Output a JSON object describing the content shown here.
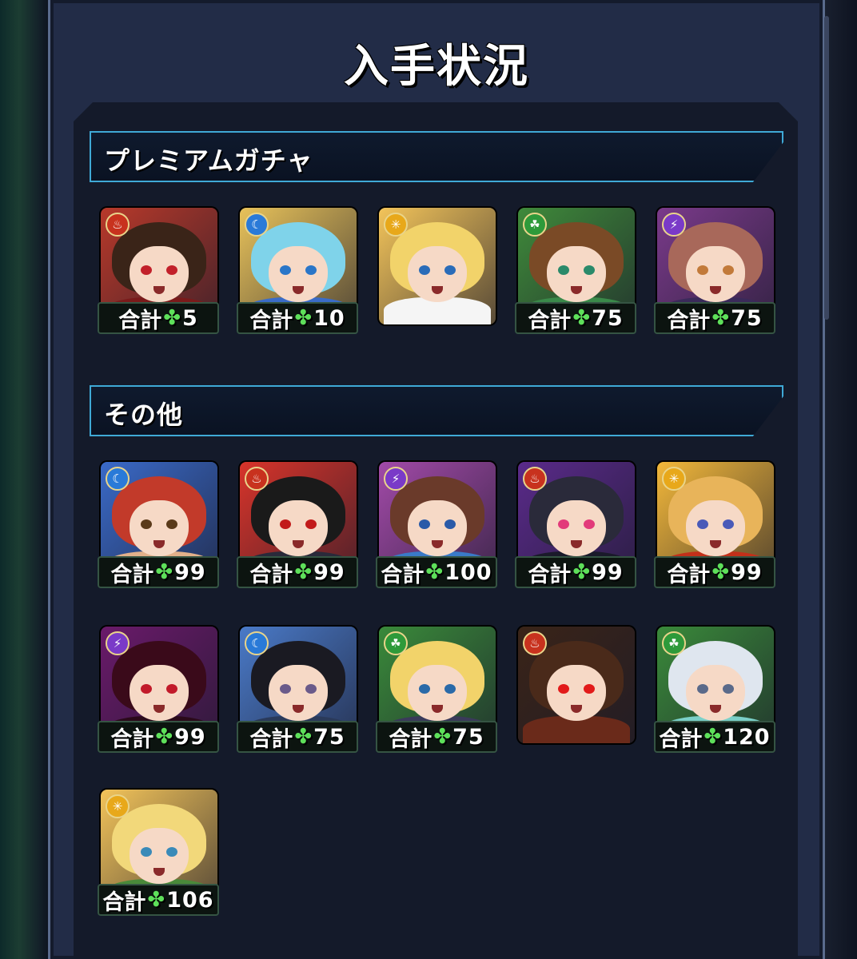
{
  "title": "入手状況",
  "sections": [
    {
      "label": "プレミアムガチャ",
      "items": [
        {
          "element": "fire",
          "hair": "#3a2418",
          "bg": "#b8392a",
          "outfit": "#7a1a1a",
          "eye": "#c2202a",
          "total_label": "合計",
          "total": "5"
        },
        {
          "element": "water",
          "hair": "#7fd3ea",
          "bg": "#e8c25a",
          "outfit": "#3a6cc8",
          "eye": "#2a76c8",
          "total_label": "合計",
          "total": "10"
        },
        {
          "element": "light",
          "hair": "#f2d36a",
          "bg": "#f3c45a",
          "outfit": "#f5f5f5",
          "eye": "#2a6cb8",
          "total_label": "",
          "total": ""
        },
        {
          "element": "wood",
          "hair": "#7a4a26",
          "bg": "#3f8a3a",
          "outfit": "#3a8a4a",
          "eye": "#2a8a6a",
          "total_label": "合計",
          "total": "75"
        },
        {
          "element": "dark",
          "hair": "#a8685a",
          "bg": "#7a3a8a",
          "outfit": "#3a2a5a",
          "eye": "#c27a3a",
          "total_label": "合計",
          "total": "75"
        }
      ]
    },
    {
      "label": "その他",
      "items": [
        {
          "element": "water",
          "hair": "#c23a2a",
          "bg": "#3a6ac8",
          "outfit": "#e2b08a",
          "eye": "#5a3a1a",
          "total_label": "合計",
          "total": "99"
        },
        {
          "element": "fire",
          "hair": "#1a1a1a",
          "bg": "#d8342a",
          "outfit": "#2a2a3a",
          "eye": "#c21a1a",
          "total_label": "合計",
          "total": "99"
        },
        {
          "element": "dark",
          "hair": "#6a3a2a",
          "bg": "#a24aa8",
          "outfit": "#3a7ac8",
          "eye": "#2a5aa8",
          "total_label": "合計",
          "total": "100"
        },
        {
          "element": "fire",
          "hair": "#2a2a3a",
          "bg": "#5a2a8a",
          "outfit": "#1a1a2a",
          "eye": "#e23a7a",
          "total_label": "合計",
          "total": "99"
        },
        {
          "element": "light",
          "hair": "#e8b45a",
          "bg": "#f3b83a",
          "outfit": "#c2301a",
          "eye": "#4a5ab8",
          "total_label": "合計",
          "total": "99"
        },
        {
          "element": "dark",
          "hair": "#3a0a1a",
          "bg": "#6a1a6a",
          "outfit": "#2a0a1a",
          "eye": "#c21a2a",
          "total_label": "合計",
          "total": "99"
        },
        {
          "element": "water",
          "hair": "#1a1a22",
          "bg": "#4a7ac8",
          "outfit": "#2a3a5a",
          "eye": "#6a5a8a",
          "total_label": "合計",
          "total": "75"
        },
        {
          "element": "wood",
          "hair": "#f2d36a",
          "bg": "#3a8a3a",
          "outfit": "#3a3a5a",
          "eye": "#2a6aa8",
          "total_label": "合計",
          "total": "75"
        },
        {
          "element": "fire",
          "hair": "#4a2a1a",
          "bg": "#3a2418",
          "outfit": "#6a2a1a",
          "eye": "#e21a1a",
          "total_label": "",
          "total": ""
        },
        {
          "element": "wood",
          "hair": "#dfe6ef",
          "bg": "#3a8a3a",
          "outfit": "#7ad0c8",
          "eye": "#5a6a8a",
          "total_label": "合計",
          "total": "120"
        },
        {
          "element": "light",
          "hair": "#f2d87a",
          "bg": "#f3c45a",
          "outfit": "#4a8a3a",
          "eye": "#3a8ab8",
          "total_label": "合計",
          "total": "106"
        }
      ]
    }
  ],
  "element_glyphs": {
    "fire": "♨",
    "water": "☾",
    "light": "✳",
    "wood": "☘",
    "dark": "⚡"
  },
  "element_colors": {
    "fire": "#c8321e",
    "water": "#2a7ad8",
    "light": "#e8a81a",
    "wood": "#2e9a3a",
    "dark": "#7a3ac8"
  },
  "clover_glyph": "✤"
}
